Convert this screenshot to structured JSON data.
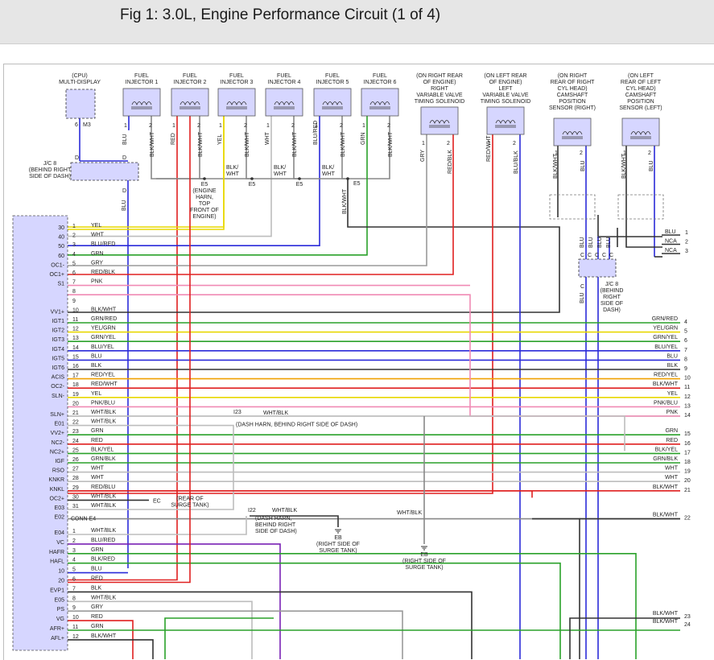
{
  "title": "Fig 1: 3.0L, Engine Performance Circuit (1 of 4)",
  "colors": {
    "YEL": "#e8d800",
    "WHT": "#bdbdbd",
    "BLU": "#2b2bd9",
    "GRN": "#2aa12a",
    "GRY": "#9a9a9a",
    "RED": "#e02020",
    "PNK": "#f08ab4",
    "BLK": "#333333",
    "ORN": "#f0a000",
    "VIO": "#7a22b5",
    "ECM_FILL": "#d6d6ff"
  },
  "components": {
    "cpu": [
      "(CPU)",
      "MULTI-DISPLAY"
    ],
    "cpu_pins": [
      "6",
      "M3"
    ],
    "injectors": [
      {
        "name": [
          "FUEL",
          "INJECTOR 1"
        ],
        "wires": [
          "BLU",
          "BLK/WHT"
        ],
        "pins": [
          "1",
          "2"
        ]
      },
      {
        "name": [
          "FUEL",
          "INJECTOR 2"
        ],
        "wires": [
          "RED",
          "BLK/WHT"
        ],
        "pins": [
          "1",
          "2"
        ]
      },
      {
        "name": [
          "FUEL",
          "INJECTOR 3"
        ],
        "wires": [
          "YEL",
          "BLK/WHT"
        ],
        "pins": [
          "1",
          "2"
        ]
      },
      {
        "name": [
          "FUEL",
          "INJECTOR 4"
        ],
        "wires": [
          "WHT",
          "BLK/WHT"
        ],
        "pins": [
          "1",
          "2"
        ]
      },
      {
        "name": [
          "FUEL",
          "INJECTOR 5"
        ],
        "wires": [
          "BLU/RED",
          "BLK/WHT"
        ],
        "pins": [
          "1",
          "2"
        ]
      },
      {
        "name": [
          "FUEL",
          "INJECTOR 6"
        ],
        "wires": [
          "GRN",
          "BLK/WHT"
        ],
        "pins": [
          "1",
          "2"
        ]
      }
    ],
    "vvt_right": {
      "name": [
        "(ON RIGHT REAR",
        "OF ENGINE)",
        "RIGHT",
        "VARIABLE VALVE",
        "TIMING SOLENOID"
      ],
      "wires": [
        "GRY",
        "RED/BLK"
      ],
      "pins": [
        "1",
        "2"
      ]
    },
    "vvt_left": {
      "name": [
        "(ON LEFT REAR",
        "OF ENGINE)",
        "LEFT",
        "VARIABLE VALVE",
        "TIMING SOLENOID"
      ],
      "wires": [
        "RED/WHT",
        "BLU/BLK"
      ],
      "pins": [
        "1",
        "2"
      ]
    },
    "cam_right": {
      "name": [
        "(ON RIGHT",
        "REAR OF RIGHT",
        "CYL HEAD)",
        "CAMSHAFT",
        "POSITION",
        "SENSOR (RIGHT)"
      ],
      "wires": [
        "BLK/WHT",
        "BLU"
      ],
      "pins": [
        "1",
        "2"
      ]
    },
    "cam_left": {
      "name": [
        "(ON LEFT",
        "REAR OF LEFT",
        "CYL HEAD)",
        "CAMSHAFT",
        "POSITION",
        "SENSOR (LEFT)"
      ],
      "wires": [
        "BLK/WHT",
        "BLU"
      ],
      "pins": [
        "1",
        "2"
      ]
    },
    "jc8_top": [
      "J/C 8",
      "(BEHIND RIGHT",
      "SIDE OF DASH)"
    ],
    "jc8_pin_d": "D",
    "jc8_wire": "BLU",
    "e5_splice": [
      "E5",
      "(ENGINE",
      "HARN,",
      "TOP",
      "FRONT OF",
      "ENGINE)"
    ],
    "e5_labels": [
      "E5",
      "E5",
      "E5"
    ],
    "e5_wires": [
      "BLK/",
      "WHT",
      "BLK/",
      "WHT",
      "BLK/",
      "WHT",
      "BLK/WHT"
    ],
    "jc8_right": [
      "J/C 8",
      "(BEHIND",
      "RIGHT",
      "SIDE OF",
      "DASH)"
    ],
    "jc8_right_pins": [
      "C",
      "C",
      "C",
      "C",
      "C"
    ],
    "jc8_right_wires": [
      "BLU",
      "BLU",
      "BLU",
      "BLU",
      "BLU"
    ],
    "right_terms": [
      {
        "label": "BLU",
        "num": "1"
      },
      {
        "label": "NCA",
        "num": "2"
      },
      {
        "label": "NCA",
        "num": "3"
      }
    ]
  },
  "ecm_top_pins": [
    {
      "ecm": "30",
      "pin": "1",
      "wire": "YEL",
      "color": "YEL"
    },
    {
      "ecm": "40",
      "pin": "2",
      "wire": "WHT",
      "color": "WHT"
    },
    {
      "ecm": "50",
      "pin": "3",
      "wire": "BLU/RED",
      "color": "BLU"
    },
    {
      "ecm": "60",
      "pin": "4",
      "wire": "GRN",
      "color": "GRN"
    },
    {
      "ecm": "OC1-",
      "pin": "5",
      "wire": "GRY",
      "color": "GRY"
    },
    {
      "ecm": "OC1+",
      "pin": "6",
      "wire": "RED/BLK",
      "color": "RED"
    },
    {
      "ecm": "S1",
      "pin": "7",
      "wire": "PNK",
      "color": "PNK"
    },
    {
      "ecm": "",
      "pin": "8",
      "wire": "",
      "color": "WHT"
    },
    {
      "ecm": "",
      "pin": "9",
      "wire": "",
      "color": ""
    },
    {
      "ecm": "VV1+",
      "pin": "10",
      "wire": "BLK/WHT",
      "color": "BLK"
    },
    {
      "ecm": "IGT1",
      "pin": "11",
      "wire": "GRN/RED",
      "color": "GRN",
      "right": "GRN/RED",
      "num": "4"
    },
    {
      "ecm": "IGT2",
      "pin": "12",
      "wire": "YEL/GRN",
      "color": "YEL",
      "right": "YEL/GRN",
      "num": "5"
    },
    {
      "ecm": "IGT3",
      "pin": "13",
      "wire": "GRN/YEL",
      "color": "GRN",
      "right": "GRN/YEL",
      "num": "6"
    },
    {
      "ecm": "IGT4",
      "pin": "14",
      "wire": "BLU/YEL",
      "color": "BLU",
      "right": "BLU/YEL",
      "num": "7"
    },
    {
      "ecm": "IGT5",
      "pin": "15",
      "wire": "BLU",
      "color": "BLU",
      "right": "BLU",
      "num": "8"
    },
    {
      "ecm": "IGT6",
      "pin": "16",
      "wire": "BLK",
      "color": "BLK",
      "right": "BLK",
      "num": "9"
    },
    {
      "ecm": "ACIS",
      "pin": "17",
      "wire": "RED/YEL",
      "color": "ORN",
      "right": "RED/YEL",
      "num": "10"
    },
    {
      "ecm": "OC2-",
      "pin": "18",
      "wire": "RED/WHT",
      "color": "RED",
      "right": "BLK/WHT",
      "num": "11"
    },
    {
      "ecm": "SLN-",
      "pin": "19",
      "wire": "YEL",
      "color": "YEL",
      "right": "YEL",
      "num": "12"
    },
    {
      "ecm": "",
      "pin": "20",
      "wire": "PNK/BLU",
      "color": "PNK",
      "right": "PNK/BLU",
      "num": "13"
    },
    {
      "ecm": "SLN+",
      "pin": "21",
      "wire": "WHT/BLK",
      "color": "WHT",
      "right": "PNK",
      "num": "14"
    },
    {
      "ecm": "E01",
      "pin": "22",
      "wire": "WHT/BLK",
      "color": "WHT"
    },
    {
      "ecm": "VV2+",
      "pin": "23",
      "wire": "GRN",
      "color": "GRN",
      "right": "GRN",
      "num": "15"
    },
    {
      "ecm": "NC2-",
      "pin": "24",
      "wire": "RED",
      "color": "RED",
      "right": "RED",
      "num": "16"
    },
    {
      "ecm": "NC2+",
      "pin": "25",
      "wire": "BLK/YEL",
      "color": "GRN",
      "right": "BLK/YEL",
      "num": "17"
    },
    {
      "ecm": "IGF",
      "pin": "26",
      "wire": "GRN/BLK",
      "color": "GRN",
      "right": "GRN/BLK",
      "num": "18"
    },
    {
      "ecm": "RSO",
      "pin": "27",
      "wire": "WHT",
      "color": "WHT",
      "right": "WHT",
      "num": "19"
    },
    {
      "ecm": "KNKR",
      "pin": "28",
      "wire": "WHT",
      "color": "WHT",
      "right": "WHT",
      "num": "20"
    },
    {
      "ecm": "KNKL",
      "pin": "29",
      "wire": "RED/BLU",
      "color": "RED",
      "right": "BLK/WHT",
      "num": "21"
    },
    {
      "ecm": "OC2+",
      "pin": "30",
      "wire": "WHT/BLK",
      "color": "WHT"
    },
    {
      "ecm": "E03",
      "pin": "31",
      "wire": "WHT/BLK",
      "color": "WHT"
    },
    {
      "ecm": "E02",
      "pin": "",
      "wire": "",
      "color": "",
      "right": "BLK/WHT",
      "num": "22"
    }
  ],
  "i23": {
    "id": "I23",
    "wire": "WHT/BLK",
    "note": "(DASH HARN, BEHIND RIGHT SIDE OF DASH)"
  },
  "ec": {
    "label": "EC",
    "note": [
      "(REAR OF",
      "SURGE TANK)"
    ]
  },
  "conn_label": "CONN E4",
  "i22": {
    "id": "I22",
    "wire": "WHT/BLK",
    "note": [
      "(DASH HARN,",
      "BEHIND RIGHT",
      "SIDE OF DASH)"
    ]
  },
  "eb1": {
    "label": "EB",
    "note": [
      "(RIGHT SIDE OF",
      "SURGE TANK)"
    ]
  },
  "eb2": {
    "label": "EB",
    "note": [
      "(RIGHT SIDE OF",
      "SURGE TANK)"
    ],
    "wire": "WHT/BLK"
  },
  "ecm_bottom_pins": [
    {
      "ecm": "E04",
      "pin": "1",
      "wire": "WHT/BLK",
      "color": "WHT"
    },
    {
      "ecm": "VC",
      "pin": "2",
      "wire": "BLU/RED",
      "color": "VIO"
    },
    {
      "ecm": "HAFR",
      "pin": "3",
      "wire": "GRN",
      "color": "GRN"
    },
    {
      "ecm": "HAFL",
      "pin": "4",
      "wire": "BLK/RED",
      "color": "GRN"
    },
    {
      "ecm": "10",
      "pin": "5",
      "wire": "BLU",
      "color": "BLU"
    },
    {
      "ecm": "20",
      "pin": "6",
      "wire": "RED",
      "color": "RED"
    },
    {
      "ecm": "EVP1",
      "pin": "7",
      "wire": "BLK",
      "color": "BLK"
    },
    {
      "ecm": "E05",
      "pin": "8",
      "wire": "WHT/BLK",
      "color": "WHT"
    },
    {
      "ecm": "PS",
      "pin": "9",
      "wire": "GRY",
      "color": "GRY"
    },
    {
      "ecm": "VG",
      "pin": "10",
      "wire": "RED",
      "color": "RED"
    },
    {
      "ecm": "AFR+",
      "pin": "11",
      "wire": "GRN",
      "color": "GRN"
    },
    {
      "ecm": "AFL+",
      "pin": "12",
      "wire": "BLK/WHT",
      "color": "BLK"
    }
  ],
  "bottom_right": [
    {
      "label": "BLK/WHT",
      "num": "23"
    },
    {
      "label": "BLK/WHT",
      "num": "24"
    }
  ]
}
